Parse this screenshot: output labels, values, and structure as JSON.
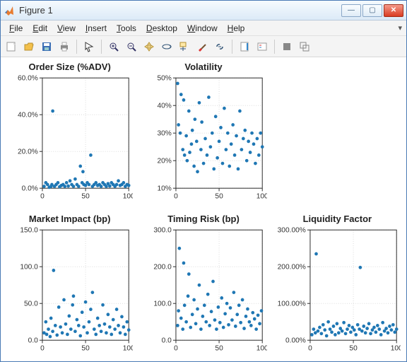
{
  "window": {
    "title": "Figure 1",
    "buttons": {
      "min": "—",
      "max": "▢",
      "close": "✕"
    }
  },
  "menubar": {
    "file": "File",
    "edit": "Edit",
    "view": "View",
    "insert": "Insert",
    "tools": "Tools",
    "desktop": "Desktop",
    "window": "Window",
    "help": "Help"
  },
  "toolbar": {
    "icons": [
      "new-figure",
      "open",
      "save",
      "print",
      "edit-plot",
      "zoom-in",
      "zoom-out",
      "pan",
      "rotate3d",
      "data-cursor",
      "brush",
      "link",
      "insert-colorbar",
      "insert-legend",
      "hide-plot",
      "show-plot"
    ]
  },
  "chart_data": [
    {
      "id": "order_size",
      "type": "scatter",
      "title": "Order Size (%ADV)",
      "xlabel": "",
      "ylabel": "",
      "xlim": [
        0,
        100
      ],
      "ylim": [
        0,
        60
      ],
      "xticks": [
        0,
        50,
        100
      ],
      "yticks": [
        0,
        20,
        40,
        60
      ],
      "ytick_fmt": "pct1",
      "points": [
        [
          2,
          1
        ],
        [
          4,
          3
        ],
        [
          6,
          2
        ],
        [
          8,
          0.5
        ],
        [
          10,
          1
        ],
        [
          11,
          2
        ],
        [
          12,
          42
        ],
        [
          14,
          1
        ],
        [
          16,
          2
        ],
        [
          18,
          3
        ],
        [
          20,
          0.8
        ],
        [
          22,
          1.5
        ],
        [
          24,
          2
        ],
        [
          26,
          1
        ],
        [
          28,
          3
        ],
        [
          30,
          1.2
        ],
        [
          32,
          4
        ],
        [
          34,
          2
        ],
        [
          36,
          1
        ],
        [
          38,
          5
        ],
        [
          40,
          2
        ],
        [
          42,
          1
        ],
        [
          44,
          12
        ],
        [
          46,
          3
        ],
        [
          47,
          9
        ],
        [
          48,
          2
        ],
        [
          50,
          1.5
        ],
        [
          52,
          3
        ],
        [
          54,
          2
        ],
        [
          56,
          18
        ],
        [
          58,
          1
        ],
        [
          60,
          2
        ],
        [
          62,
          3
        ],
        [
          64,
          1.5
        ],
        [
          66,
          2
        ],
        [
          68,
          1
        ],
        [
          70,
          3
        ],
        [
          72,
          2
        ],
        [
          74,
          1
        ],
        [
          76,
          2.5
        ],
        [
          78,
          1.2
        ],
        [
          80,
          3
        ],
        [
          82,
          2
        ],
        [
          84,
          1
        ],
        [
          86,
          2
        ],
        [
          88,
          4
        ],
        [
          90,
          1.5
        ],
        [
          92,
          2
        ],
        [
          94,
          3
        ],
        [
          96,
          1
        ],
        [
          98,
          2
        ],
        [
          100,
          1.5
        ]
      ]
    },
    {
      "id": "volatility",
      "type": "scatter",
      "title": "Volatility",
      "xlabel": "",
      "ylabel": "",
      "xlim": [
        0,
        100
      ],
      "ylim": [
        10,
        50
      ],
      "xticks": [
        0,
        50,
        100
      ],
      "yticks": [
        10,
        20,
        30,
        40,
        50
      ],
      "ytick_fmt": "pct0",
      "points": [
        [
          2,
          48
        ],
        [
          3,
          33
        ],
        [
          5,
          30
        ],
        [
          6,
          44
        ],
        [
          8,
          24
        ],
        [
          9,
          42
        ],
        [
          10,
          22
        ],
        [
          12,
          29
        ],
        [
          13,
          20
        ],
        [
          15,
          38
        ],
        [
          16,
          23
        ],
        [
          18,
          26
        ],
        [
          19,
          31
        ],
        [
          21,
          18
        ],
        [
          22,
          35
        ],
        [
          24,
          27
        ],
        [
          25,
          16
        ],
        [
          27,
          41
        ],
        [
          29,
          24
        ],
        [
          30,
          34
        ],
        [
          32,
          19
        ],
        [
          34,
          28
        ],
        [
          36,
          22
        ],
        [
          38,
          43
        ],
        [
          40,
          25
        ],
        [
          42,
          30
        ],
        [
          44,
          17
        ],
        [
          46,
          36
        ],
        [
          48,
          21
        ],
        [
          50,
          27
        ],
        [
          52,
          32
        ],
        [
          54,
          19
        ],
        [
          56,
          39
        ],
        [
          58,
          24
        ],
        [
          60,
          30
        ],
        [
          62,
          18
        ],
        [
          64,
          26
        ],
        [
          66,
          33
        ],
        [
          68,
          22
        ],
        [
          70,
          29
        ],
        [
          72,
          17
        ],
        [
          74,
          38
        ],
        [
          76,
          24
        ],
        [
          78,
          28
        ],
        [
          80,
          31
        ],
        [
          82,
          20
        ],
        [
          84,
          27
        ],
        [
          86,
          23
        ],
        [
          88,
          30
        ],
        [
          90,
          26
        ],
        [
          92,
          19
        ],
        [
          94,
          28
        ],
        [
          96,
          22
        ],
        [
          98,
          30
        ],
        [
          100,
          25
        ]
      ]
    },
    {
      "id": "market_impact",
      "type": "scatter",
      "title": "Market Impact (bp)",
      "xlabel": "",
      "ylabel": "",
      "xlim": [
        0,
        100
      ],
      "ylim": [
        0,
        150
      ],
      "xticks": [
        0,
        50,
        100
      ],
      "yticks": [
        0,
        50,
        100,
        150
      ],
      "ytick_fmt": "num1",
      "points": [
        [
          2,
          10
        ],
        [
          4,
          25
        ],
        [
          5,
          8
        ],
        [
          7,
          15
        ],
        [
          9,
          5
        ],
        [
          10,
          30
        ],
        [
          12,
          12
        ],
        [
          13,
          95
        ],
        [
          15,
          20
        ],
        [
          17,
          7
        ],
        [
          19,
          45
        ],
        [
          21,
          18
        ],
        [
          23,
          10
        ],
        [
          25,
          55
        ],
        [
          27,
          22
        ],
        [
          29,
          8
        ],
        [
          31,
          33
        ],
        [
          33,
          15
        ],
        [
          35,
          48
        ],
        [
          36,
          60
        ],
        [
          38,
          12
        ],
        [
          40,
          28
        ],
        [
          42,
          20
        ],
        [
          44,
          6
        ],
        [
          46,
          38
        ],
        [
          48,
          18
        ],
        [
          50,
          52
        ],
        [
          52,
          10
        ],
        [
          54,
          25
        ],
        [
          56,
          42
        ],
        [
          58,
          65
        ],
        [
          60,
          15
        ],
        [
          62,
          8
        ],
        [
          64,
          30
        ],
        [
          66,
          20
        ],
        [
          68,
          12
        ],
        [
          70,
          48
        ],
        [
          72,
          22
        ],
        [
          74,
          10
        ],
        [
          76,
          35
        ],
        [
          78,
          18
        ],
        [
          80,
          8
        ],
        [
          82,
          28
        ],
        [
          84,
          15
        ],
        [
          86,
          42
        ],
        [
          88,
          20
        ],
        [
          90,
          10
        ],
        [
          92,
          32
        ],
        [
          94,
          18
        ],
        [
          96,
          8
        ],
        [
          98,
          25
        ],
        [
          100,
          14
        ]
      ]
    },
    {
      "id": "timing_risk",
      "type": "scatter",
      "title": "Timing Risk (bp)",
      "xlabel": "",
      "ylabel": "",
      "xlim": [
        0,
        100
      ],
      "ylim": [
        0,
        300
      ],
      "xticks": [
        0,
        50,
        100
      ],
      "yticks": [
        0,
        100,
        200,
        300
      ],
      "ytick_fmt": "num1",
      "points": [
        [
          2,
          40
        ],
        [
          3,
          80
        ],
        [
          4,
          250
        ],
        [
          6,
          60
        ],
        [
          8,
          30
        ],
        [
          9,
          210
        ],
        [
          10,
          95
        ],
        [
          12,
          50
        ],
        [
          14,
          120
        ],
        [
          15,
          180
        ],
        [
          17,
          35
        ],
        [
          19,
          70
        ],
        [
          21,
          110
        ],
        [
          23,
          45
        ],
        [
          25,
          85
        ],
        [
          27,
          150
        ],
        [
          29,
          30
        ],
        [
          31,
          65
        ],
        [
          33,
          95
        ],
        [
          35,
          50
        ],
        [
          37,
          125
        ],
        [
          39,
          40
        ],
        [
          41,
          78
        ],
        [
          43,
          160
        ],
        [
          45,
          55
        ],
        [
          47,
          30
        ],
        [
          49,
          90
        ],
        [
          51,
          48
        ],
        [
          53,
          115
        ],
        [
          55,
          35
        ],
        [
          57,
          72
        ],
        [
          59,
          100
        ],
        [
          61,
          42
        ],
        [
          63,
          88
        ],
        [
          65,
          55
        ],
        [
          67,
          130
        ],
        [
          69,
          38
        ],
        [
          71,
          70
        ],
        [
          73,
          95
        ],
        [
          75,
          48
        ],
        [
          77,
          110
        ],
        [
          79,
          32
        ],
        [
          81,
          65
        ],
        [
          83,
          85
        ],
        [
          85,
          50
        ],
        [
          87,
          40
        ],
        [
          89,
          75
        ],
        [
          91,
          58
        ],
        [
          93,
          30
        ],
        [
          95,
          68
        ],
        [
          97,
          45
        ],
        [
          99,
          80
        ]
      ]
    },
    {
      "id": "liquidity_factor",
      "type": "scatter",
      "title": "Liquidity Factor",
      "xlabel": "",
      "ylabel": "",
      "xlim": [
        0,
        100
      ],
      "ylim": [
        0,
        300
      ],
      "xticks": [
        0,
        50,
        100
      ],
      "yticks": [
        0,
        100,
        200,
        300
      ],
      "ytick_fmt": "pct2",
      "points": [
        [
          2,
          15
        ],
        [
          4,
          30
        ],
        [
          6,
          20
        ],
        [
          7,
          235
        ],
        [
          9,
          25
        ],
        [
          11,
          35
        ],
        [
          13,
          18
        ],
        [
          15,
          42
        ],
        [
          17,
          28
        ],
        [
          19,
          12
        ],
        [
          21,
          50
        ],
        [
          23,
          30
        ],
        [
          25,
          22
        ],
        [
          27,
          38
        ],
        [
          29,
          15
        ],
        [
          31,
          45
        ],
        [
          33,
          20
        ],
        [
          35,
          32
        ],
        [
          37,
          25
        ],
        [
          39,
          48
        ],
        [
          41,
          18
        ],
        [
          43,
          30
        ],
        [
          45,
          40
        ],
        [
          47,
          22
        ],
        [
          49,
          35
        ],
        [
          51,
          28
        ],
        [
          53,
          15
        ],
        [
          55,
          42
        ],
        [
          57,
          30
        ],
        [
          58,
          198
        ],
        [
          60,
          25
        ],
        [
          62,
          38
        ],
        [
          64,
          20
        ],
        [
          66,
          32
        ],
        [
          68,
          45
        ],
        [
          70,
          18
        ],
        [
          72,
          28
        ],
        [
          74,
          35
        ],
        [
          76,
          22
        ],
        [
          78,
          40
        ],
        [
          80,
          30
        ],
        [
          82,
          15
        ],
        [
          84,
          48
        ],
        [
          86,
          25
        ],
        [
          88,
          32
        ],
        [
          90,
          20
        ],
        [
          92,
          38
        ],
        [
          94,
          28
        ],
        [
          96,
          42
        ],
        [
          98,
          22
        ],
        [
          100,
          30
        ]
      ]
    }
  ]
}
